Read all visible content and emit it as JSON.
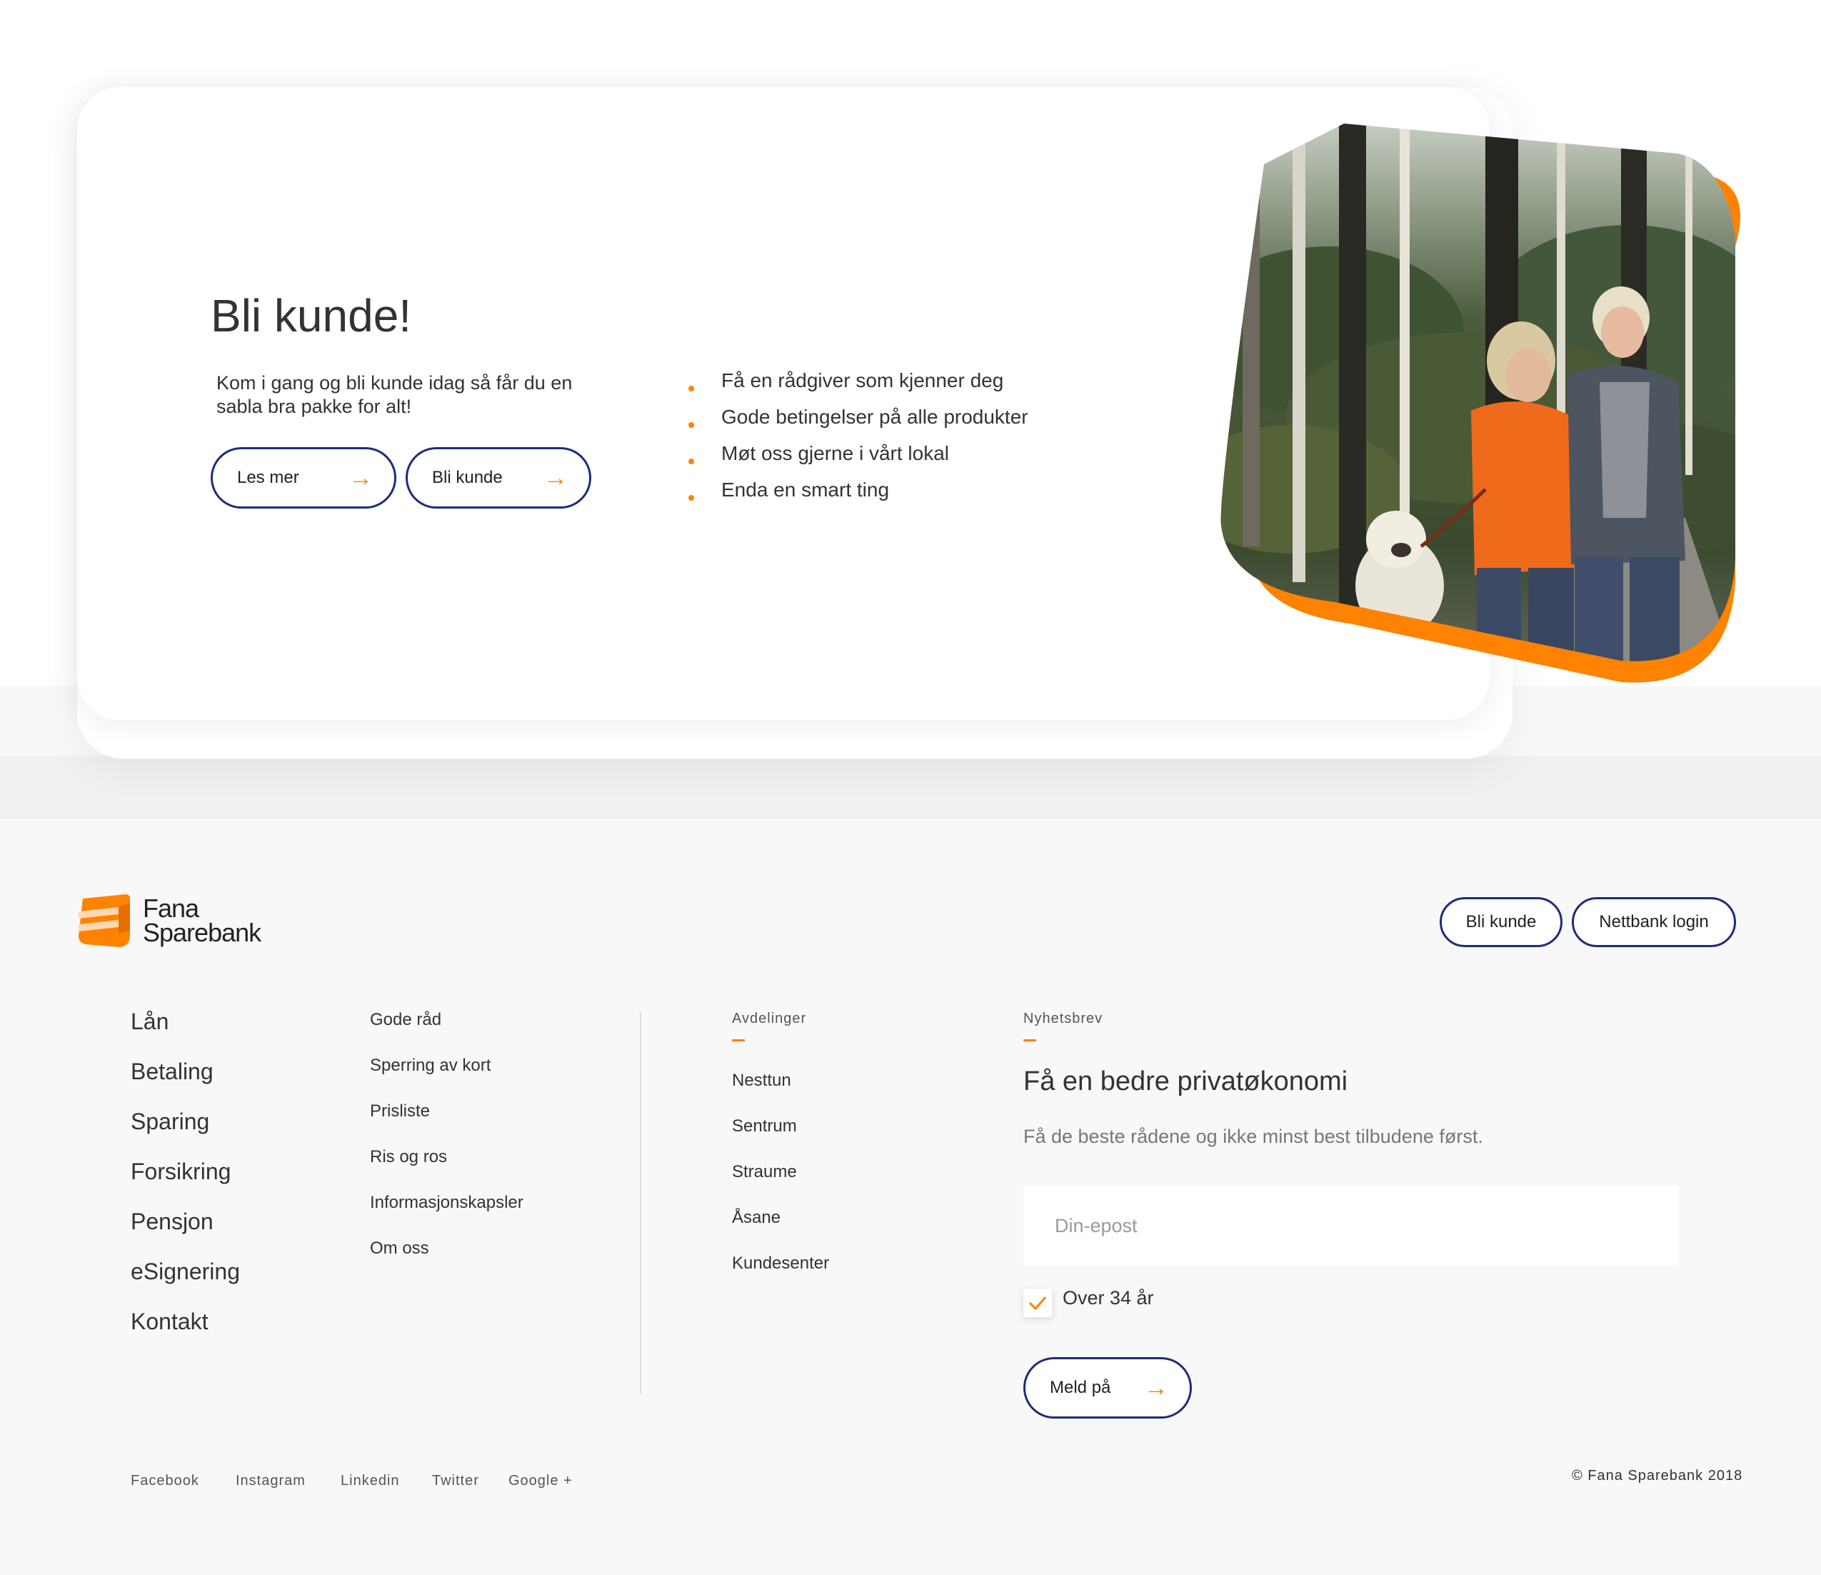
{
  "hero": {
    "title": "Bli kunde!",
    "text": "Kom i gang og bli kunde idag så får du en sabla bra pakke for alt!",
    "buttons": [
      {
        "label": "Les mer"
      },
      {
        "label": "Bli kunde"
      }
    ],
    "bullets": [
      "Få en rådgiver som kjenner deg",
      "Gode betingelser på alle produkter",
      "Møt oss gjerne i vårt lokal",
      "Enda en smart ting"
    ]
  },
  "footer": {
    "logo_line1": "Fana",
    "logo_line2": "Sparebank",
    "header_buttons": [
      "Bli kunde",
      "Nettbank login"
    ],
    "main_nav": [
      "Lån",
      "Betaling",
      "Sparing",
      "Forsikring",
      "Pensjon",
      "eSignering",
      "Kontakt"
    ],
    "secondary_nav": [
      "Gode råd",
      "Sperring av kort",
      "Prisliste",
      "Ris og ros",
      "Informasjonskapsler",
      "Om oss"
    ],
    "departments_heading": "Avdelinger",
    "departments": [
      "Nesttun",
      "Sentrum",
      "Straume",
      "Åsane",
      "Kundesenter"
    ],
    "newsletter": {
      "heading": "Nyhetsbrev",
      "title": "Få en bedre privatøkonomi",
      "subtitle": "Få de beste rådene og ikke minst best tilbudene først.",
      "email_placeholder": "Din-epost",
      "checkbox_label": "Over 34 år",
      "checkbox_checked": true,
      "submit_label": "Meld på"
    },
    "social": [
      "Facebook",
      "Instagram",
      "Linkedin",
      "Twitter",
      "Google +"
    ],
    "copyright": "© Fana Sparebank 2018"
  },
  "colors": {
    "accent": "#ff8200",
    "navy": "#1f2b7b",
    "text": "#333333",
    "footer_bg": "#f8f8f8"
  }
}
